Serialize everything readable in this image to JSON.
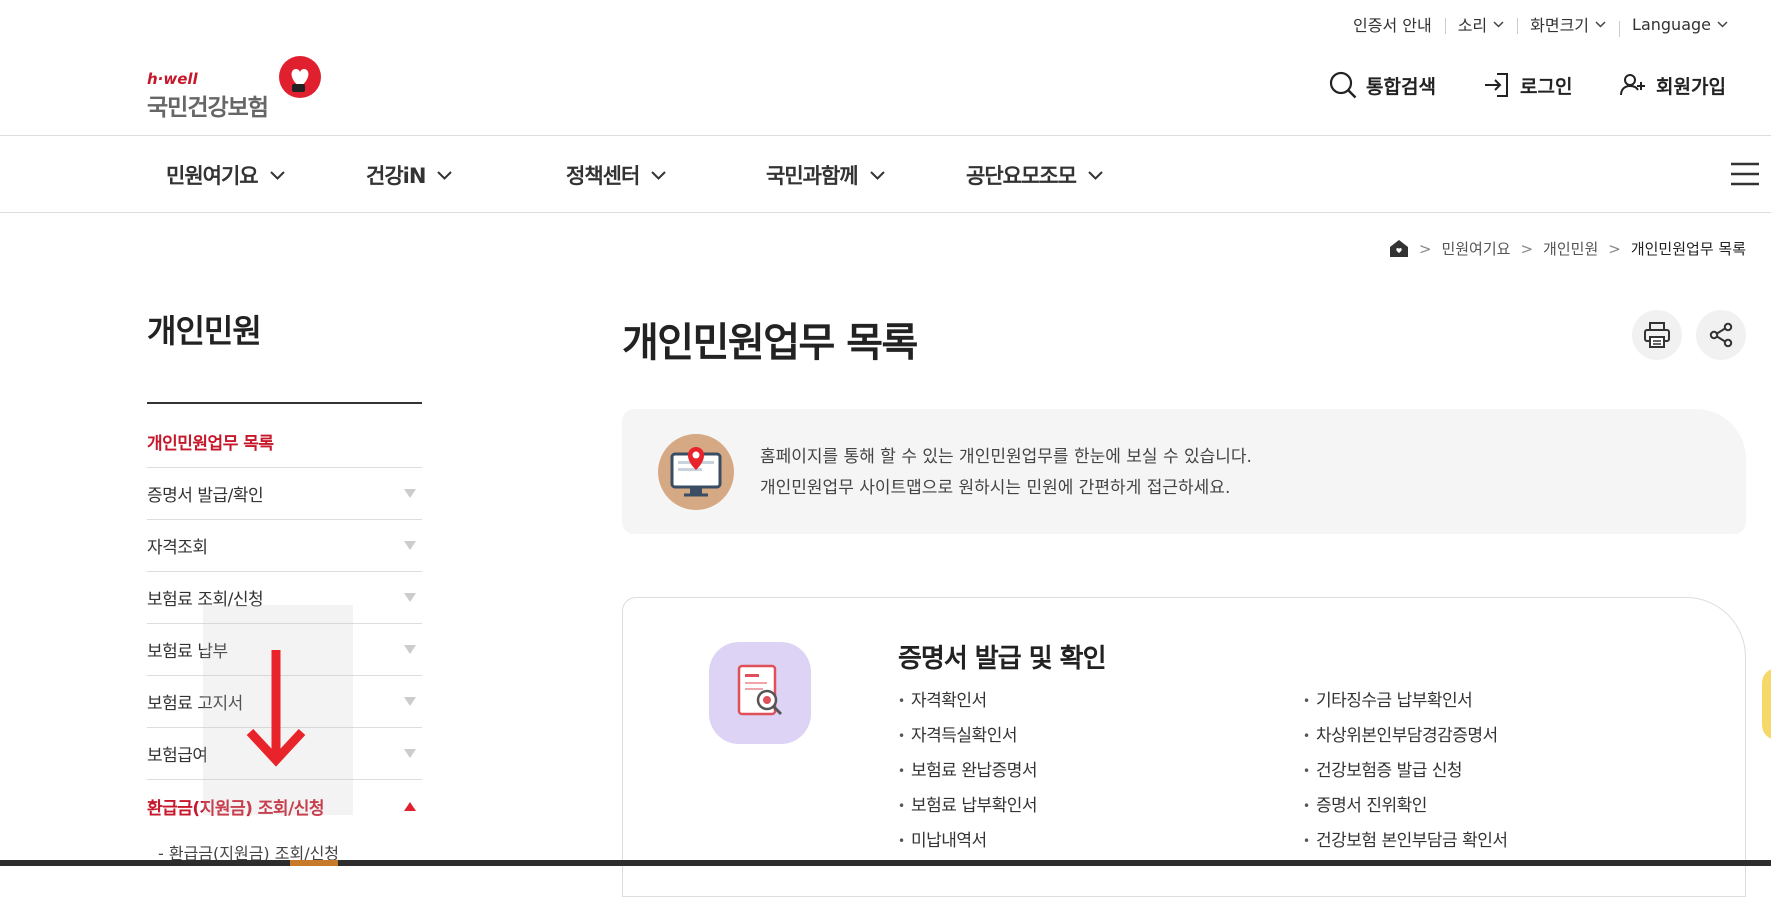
{
  "utility": {
    "cert": "인증서 안내",
    "sound": "소리",
    "zoom": "화면크기",
    "language": "Language"
  },
  "logo": {
    "tagline": "h·well",
    "name": "국민건강보험",
    "brand_color": "#c7182b"
  },
  "top_actions": {
    "search": "통합검색",
    "login": "로그인",
    "join": "회원가입"
  },
  "gnb": {
    "items": [
      {
        "label": "민원여기요"
      },
      {
        "label": "건강iN"
      },
      {
        "label": "정책센터"
      },
      {
        "label": "국민과함께"
      },
      {
        "label": "공단요모조모"
      }
    ]
  },
  "breadcrumb": {
    "items": [
      "민원여기요",
      "개인민원",
      "개인민원업무 목록"
    ]
  },
  "lnb": {
    "title": "개인민원",
    "items": [
      {
        "label": "개인민원업무 목록",
        "state": "active"
      },
      {
        "label": "증명서 발급/확인",
        "state": "collapsed"
      },
      {
        "label": "자격조회",
        "state": "collapsed"
      },
      {
        "label": "보험료 조회/신청",
        "state": "collapsed"
      },
      {
        "label": "보험료 납부",
        "state": "collapsed"
      },
      {
        "label": "보험료 고지서",
        "state": "collapsed"
      },
      {
        "label": "보험급여",
        "state": "collapsed"
      },
      {
        "label": "환급금(지원금) 조회/신청",
        "state": "expanded"
      }
    ],
    "sub_item": "환급금(지원금) 조회/신청"
  },
  "main": {
    "title": "개인민원업무 목록",
    "intro_line1": "홈페이지를 통해 할 수 있는 개인민원업무를 한눈에 보실 수 있습니다.",
    "intro_line2": "개인민원업무 사이트맵으로 원하시는 민원에 간편하게 접근하세요."
  },
  "card": {
    "title": "증명서 발급 및 확인",
    "left": [
      "자격확인서",
      "자격득실확인서",
      "보험료 완납증명서",
      "보험료 납부확인서",
      "미납내역서"
    ],
    "right": [
      "기타징수금 납부확인서",
      "차상위본인부담경감증명서",
      "건강보험증 발급 신청",
      "증명서 진위확인",
      "건강보험 본인부담금 확인서"
    ]
  },
  "colors": {
    "accent": "#c7182b",
    "arrow": "#e8232a"
  }
}
